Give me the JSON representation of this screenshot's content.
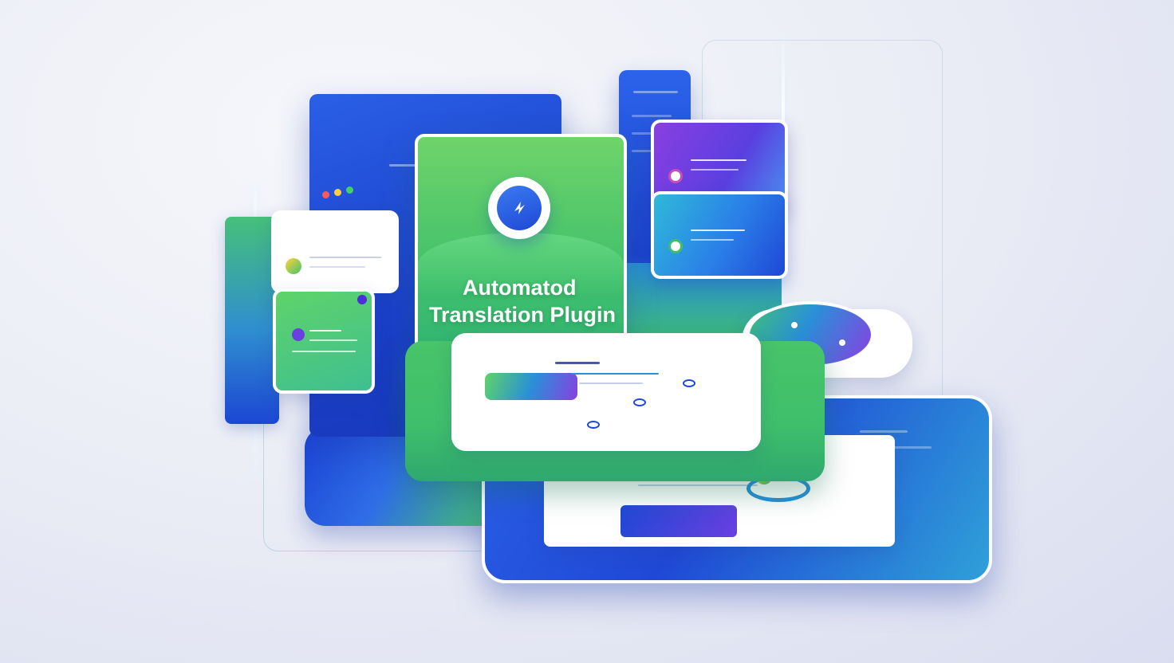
{
  "hero": {
    "title_line1": "Automatod",
    "title_line2": "Translation Plugin"
  },
  "colors": {
    "blue": "#1f48d6",
    "green": "#3fbf6b",
    "purple": "#8a3fe0",
    "white": "#ffffff"
  },
  "icons": {
    "hero": "lightning-bolt-icon",
    "window_controls": [
      "close-dot",
      "minimize-dot",
      "maximize-dot"
    ]
  }
}
